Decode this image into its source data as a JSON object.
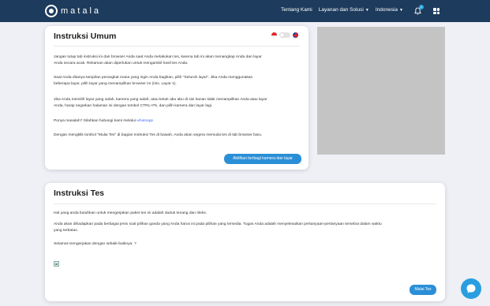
{
  "brand": {
    "name": "matala"
  },
  "nav": {
    "links": [
      {
        "label": "Tentang Kami"
      },
      {
        "label": "Layanan dan Solusi"
      },
      {
        "label": "Indonesia"
      }
    ],
    "notification_count": "1",
    "icons": [
      "bell-icon",
      "apps-grid-icon"
    ]
  },
  "general_instructions": {
    "title": "Instruksi Umum",
    "paragraphs": [
      [
        "Jangan tutup tab instruksi ini dari browser Anda saat Anda melakukan tes, karena tab ini akan menangkap Anda dan layar",
        "Anda secara acak. Rekaman akan diperlukan untuk mengambil hasil tes Anda."
      ],
      [
        "Saat Anda ditanya tampilan perangkat mana yang ingin Anda bagikan, pilih \"Seluruh layar\". Jika Anda menggunakan",
        "beberapa layar, pilih layar yang menampilkan browser ini (mis. Layar 1)."
      ],
      [
        "Jika Anda memilih layar yang salah, kamera yang salah, atau ketuk abu abu di sisi kanan tidak menampilkan Anda atau layar",
        "Anda, harap segarkan halaman ini dengan tombol CTRL+F5, dan pilih kamera dan layar lagi."
      ],
      [
        "Punya masalah? Silahkan hubungi kami melalui "
      ],
      [
        "Dengan mengklik tombol \"Mulai Tes\" di bagian Instruksi Tes di bawah, Anda akan segera memulai tes di tab browser baru."
      ]
    ],
    "contact_link": "whatsapp",
    "camera_button": "Aktifkan berbagi kamera dan layar",
    "language_flags": [
      "indonesia-flag-icon",
      "uk-flag-icon"
    ]
  },
  "test_instructions": {
    "title": "Instruksi Tes",
    "paragraphs": [
      [
        "Hal yang anda butuhkan untuk mengerjakan paket tes ini adalah duduk tenang dan rileks."
      ],
      [
        "Anda akan dihadapkan pada berbagai jenis soal pilihan ganda yang Anda harus isi pada pilihan yang tersedia. Tugas Anda adalah menyelesaikan pertanyaan-pertanyaan tersebut dalam waktu",
        "yang terbatas."
      ],
      [
        "Selamat mengerjakan dengan sebaik-baiknya. ?"
      ]
    ],
    "start_button": "Mulai Tes"
  },
  "colors": {
    "navbar": "#1d3b5c",
    "accent": "#2a8fd7",
    "link": "#4a6ef5",
    "page_bg": "#eef0f5",
    "video_placeholder": "#c4c4c4"
  }
}
